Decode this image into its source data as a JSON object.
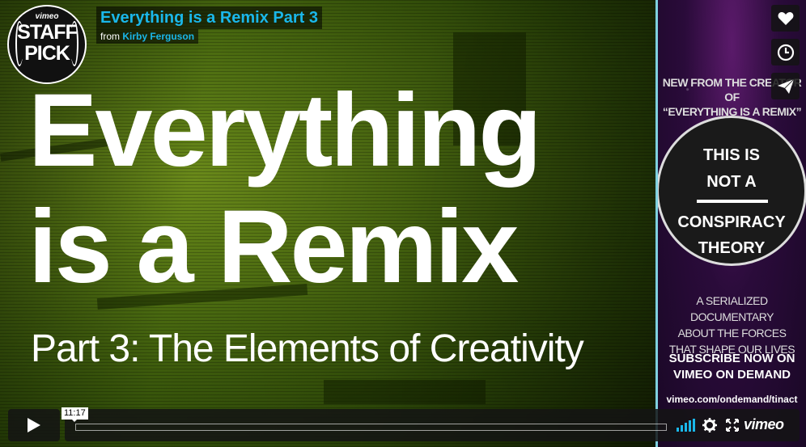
{
  "header": {
    "title": "Everything is a Remix Part 3",
    "byline_prefix": "from",
    "byline_author": "Kirby Ferguson"
  },
  "badge": {
    "brand": "vimeo",
    "line1": "STAFF",
    "line2": "PICK"
  },
  "video": {
    "line1": "Everything",
    "line2": "is a Remix",
    "subtitle": "Part 3: The Elements of Creativity"
  },
  "ad": {
    "intro_line1": "NEW FROM THE CREATOR OF",
    "intro_line2": "“EVERYTHING IS A REMIX”",
    "circle_line1": "THIS IS",
    "circle_line2": "NOT A",
    "circle_line3": "CONSPIRACY",
    "circle_line4": "THEORY",
    "desc_line1": "A SERIALIZED DOCUMENTARY",
    "desc_line2": "ABOUT THE FORCES",
    "desc_line3": "THAT SHAPE OUR LIVES",
    "cta_line1": "SUBSCRIBE NOW ON",
    "cta_line2": "VIMEO ON DEMAND",
    "url": "vimeo.com/ondemand/tinact"
  },
  "controls": {
    "time_tooltip": "11:17",
    "progress": 0.0,
    "brand": "vimeo",
    "icons": [
      "play-icon",
      "volume-icon",
      "gear-icon",
      "fullscreen-icon"
    ]
  },
  "side_actions": {
    "icons": [
      "heart-icon",
      "clock-icon",
      "paper-plane-icon"
    ]
  },
  "colors": {
    "accent": "#1ab7ea",
    "video_tint": "#4a6a10",
    "ad_bg": "#2a0b3a"
  }
}
